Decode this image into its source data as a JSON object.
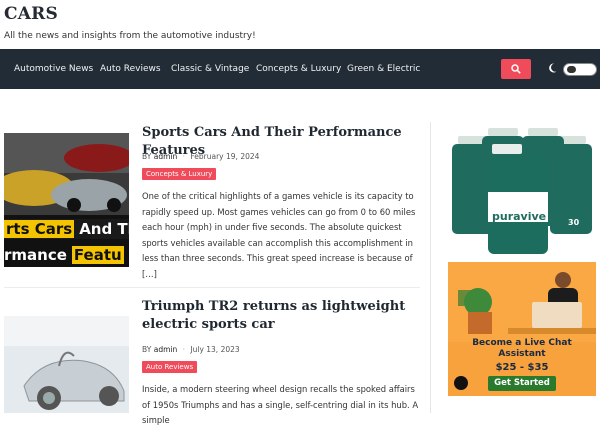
{
  "site": {
    "title": "CARS",
    "tagline": "All the news and insights from the automotive industry!"
  },
  "nav": {
    "items": [
      "Automotive News",
      "Auto Reviews",
      "Classic & Vintage",
      "Concepts & Luxury",
      "Green & Electric"
    ],
    "search_icon": "search-icon",
    "theme_icon": "moon-icon",
    "accent": "#ef4b5a",
    "bg": "#222c36"
  },
  "posts": [
    {
      "title": "Sports Cars And Their Performance Features",
      "author_prefix": "BY",
      "author": "admin",
      "date": "February 19, 2024",
      "category": "Concepts & Luxury",
      "thumb_text_1": "rts Cars",
      "thumb_text_2": "And Th",
      "thumb_text_3": "rmance",
      "thumb_text_4": "Featu",
      "excerpt": "One of the critical highlights of a games vehicle is its capacity to rapidly speed up. Most games vehicles can go from 0 to 60 miles each hour (mph) in under five seconds. The absolute quickest sports vehicles available can accomplish this accomplishment in less than three seconds. This great speed increase is because of […]"
    },
    {
      "title": "Triumph TR2 returns as lightweight electric sports car",
      "author_prefix": "BY",
      "author": "admin",
      "date": "July 13, 2023",
      "category": "Auto Reviews",
      "excerpt": "Inside, a modern steering wheel design recalls the spoked affairs of 1950s Triumphs and has a single, self-centring dial in its hub. A simple"
    }
  ],
  "sidebar": {
    "ad1": {
      "brand": "puravive",
      "subtitle": "weight loss support",
      "count": "30"
    },
    "ad2": {
      "headline": "Become a Live Chat Assistant",
      "price": "$25 - $35",
      "cta": "Get Started"
    }
  }
}
